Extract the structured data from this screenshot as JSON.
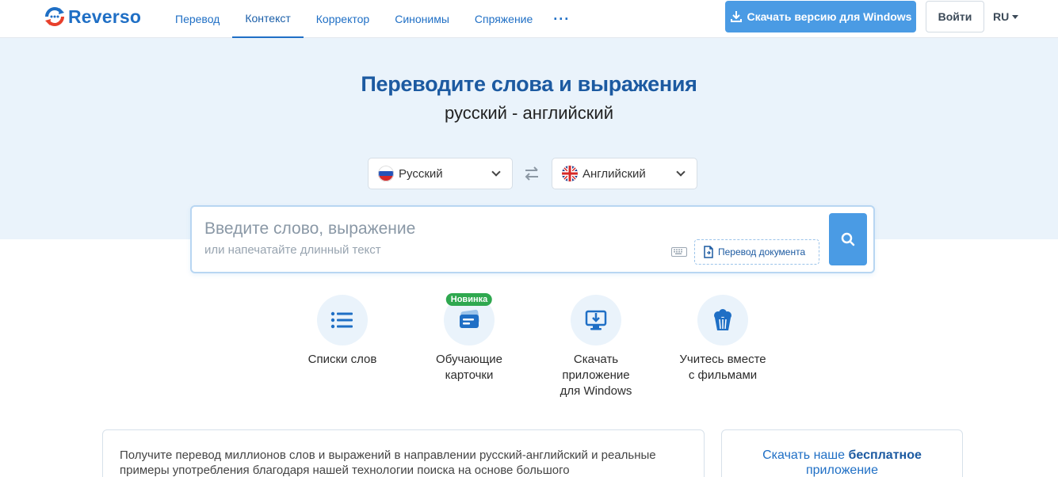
{
  "header": {
    "logo_text": "Reverso",
    "nav": [
      {
        "label": "Перевод",
        "active": false
      },
      {
        "label": "Контекст",
        "active": true
      },
      {
        "label": "Корректор",
        "active": false
      },
      {
        "label": "Синонимы",
        "active": false
      },
      {
        "label": "Спряжение",
        "active": false
      }
    ],
    "more_label": "···",
    "download_label": "Скачать версию для Windows",
    "login_label": "Войти",
    "language": "RU"
  },
  "hero": {
    "title": "Переводите слова и выражения",
    "subtitle": "русский - английский",
    "source_lang": "Русский",
    "target_lang": "Английский"
  },
  "search": {
    "placeholder_main": "Введите слово, выражение",
    "placeholder_sub": "или напечатайте длинный текст",
    "doc_button_label": "Перевод документа"
  },
  "features": [
    {
      "label": "Списки слов",
      "icon": "list-icon"
    },
    {
      "label": "Обучающие карточки",
      "icon": "flashcards-icon",
      "badge": "Новинка"
    },
    {
      "label": "Скачать приложение для Windows",
      "icon": "download-monitor-icon"
    },
    {
      "label": "Учитесь вместе с фильмами",
      "icon": "popcorn-icon"
    }
  ],
  "info": {
    "text": "Получите перевод миллионов слов и выражений в направлении русский-английский и реальные примеры употребления благодаря нашей технологии поиска на основе большого",
    "app_promo_prefix": "Скачать наше",
    "app_promo_bold": "бесплатное",
    "app_promo_suffix": "приложение"
  },
  "colors": {
    "brand": "#1f6fc5",
    "accent": "#4a9be4",
    "hero_bg": "#eaf3fb",
    "badge_green": "#2fa84f"
  }
}
